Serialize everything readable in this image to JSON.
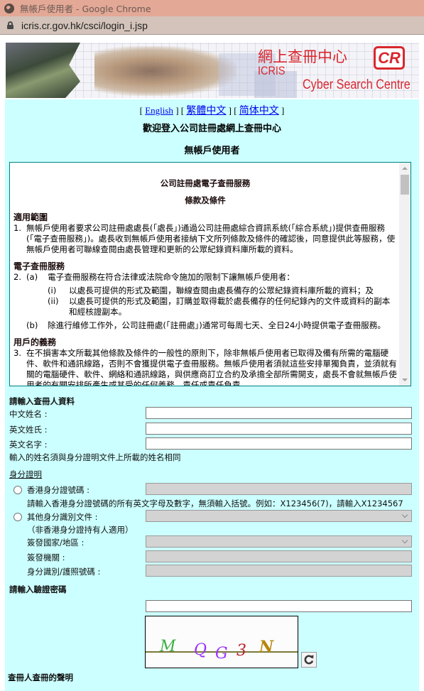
{
  "browser": {
    "window_title": "無帳戶使用者 - Google Chrome",
    "url": "icris.cr.gov.hk/csci/login_i.jsp"
  },
  "banner": {
    "zh_title": "網上查冊中心",
    "logo": "CR",
    "icris": "ICRIS",
    "subtitle": "Cyber Search Centre"
  },
  "languages": {
    "open": "[ ",
    "english": "English",
    "sep1": " ] [ ",
    "traditional": "繁體中文",
    "sep2": " ] [ ",
    "simplified": "简体中文",
    "close": " ]"
  },
  "header": {
    "welcome": "歡迎登入公司註冊處網上查冊中心",
    "user_type": "無帳戶使用者"
  },
  "terms": {
    "title": "公司註冊處電子查冊服務",
    "subtitle": "條款及條件",
    "sections": [
      {
        "heading": "適用範圍",
        "num": "1.",
        "text": "無帳戶使用者要求公司註冊處處長(「處長」)通過公司註冊處綜合資訊系統(「綜合系統」)提供查冊服務(「電子查冊服務」)。處長收到無帳戶使用者接納下文所列條款及條件的確認後，同意提供此等服務，使無帳戶使用者可聯線查閱由處長管理和更新的公眾紀錄資料庫所載的資料。"
      },
      {
        "heading": "電子查冊服務",
        "num": "2.",
        "a_label": "(a)",
        "a_text": "電子查冊服務在符合法律或法院命令施加的限制下讓無帳戶使用者：",
        "i_label": "(i)",
        "i_text": "以處長可提供的形式及範圍，聯線查閱由處長備存的公眾紀錄資料庫所載的資料；及",
        "ii_label": "(ii)",
        "ii_text": "以處長可提供的形式及範圍，訂購並取得載於處長備存的任何紀錄內的文件或資料的副本和經核證副本。",
        "b_label": "(b)",
        "b_text": "除進行維修工作外，公司註冊處(「註冊處」)通常可每周七天、全日24小時提供電子查冊服務。"
      },
      {
        "heading": "用戶的義務",
        "num": "3.",
        "text": "在不損害本文所載其他條款及條件的一般性的原則下，除非無帳戶使用者已取得及備有所需的電腦硬件、軟件和通訊線路，否則不會獲提供電子查冊服務。無帳戶使用者須就這些安排單獨負責，並須就有關的電腦硬件、軟件、網絡和通訊線路，與供應商訂立合約及承擔全部所需開支，處長不會就無帳戶使用者的有關安排所產生或其受的任何義務、責任或責任負責。"
      }
    ]
  },
  "form": {
    "searcher_heading": "請輸入查冊人資料",
    "chinese_name_label": "中文姓名 :",
    "chinese_name_value": "",
    "english_surname_label": "英文姓氏 :",
    "english_surname_value": "",
    "english_given_label": "英文名字 :",
    "english_given_value": "",
    "name_note": "輸入的姓名須與身分證明文件上所載的姓名相同",
    "id_heading": "身分證明",
    "hkid_label": "香港身分證號碼 :",
    "hkid_value": "",
    "hkid_note": "請輸入香港身分證號碼的所有英文字母及數字，無須輸入括號。例如：X123456(7)，請輸入X1234567",
    "other_id_label": "其他身分識別文件 :",
    "other_id_selected": "",
    "other_id_note": "（非香港身分證持有人適用）",
    "country_label": "簽發國家/地區 :",
    "country_selected": "",
    "authority_label": "簽發機關 :",
    "authority_value": "",
    "passport_label": "身分識別/護照號碼 :",
    "passport_value": "",
    "captcha_heading": "請輸入驗證密碼",
    "captcha_value": "",
    "captcha_chars": [
      "M",
      "Q",
      "G",
      "3",
      "N"
    ],
    "captcha_colors": [
      "#3cb043",
      "#9b30ff",
      "#9b30ff",
      "#c0202c",
      "#b8860b"
    ],
    "declaration_heading": "查冊人查冊的聲明"
  },
  "colors": {
    "panel_bg": "#ccffff",
    "terms_border": "#008080",
    "brand_red": "#d9272e",
    "link": "#0000ee"
  }
}
